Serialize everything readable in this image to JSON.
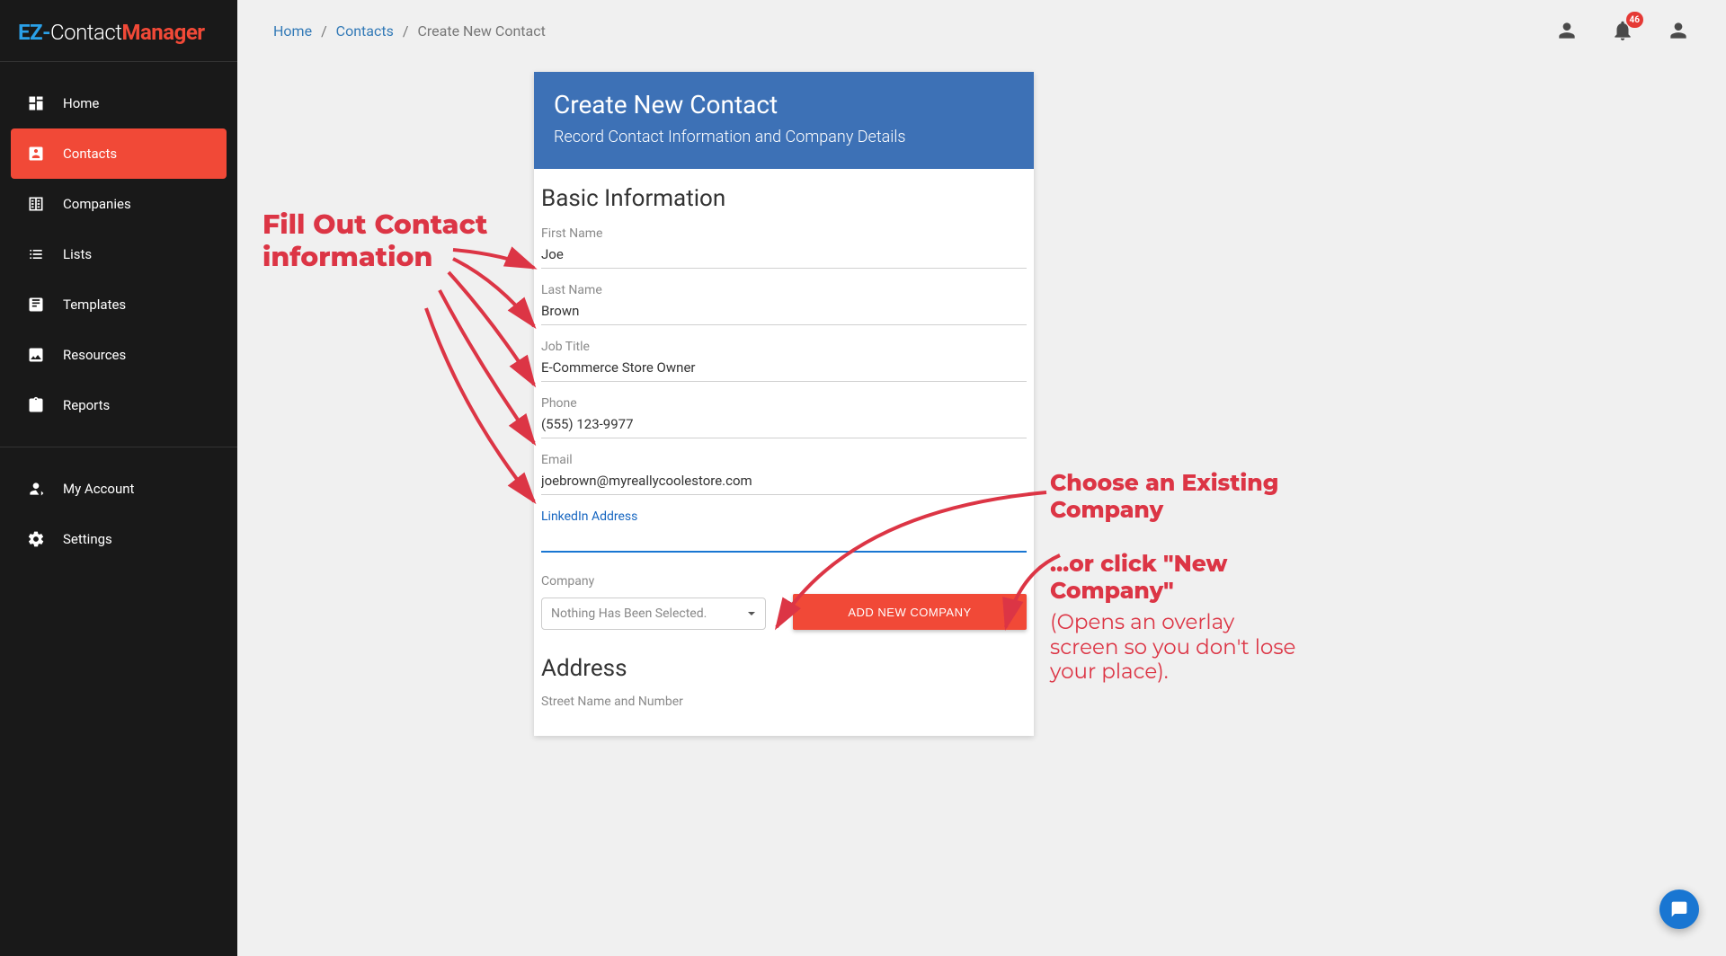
{
  "logo": {
    "p1": "EZ-",
    "p2": "Contact",
    "p3": "Manager"
  },
  "sidebar": {
    "items": [
      {
        "label": "Home"
      },
      {
        "label": "Contacts"
      },
      {
        "label": "Companies"
      },
      {
        "label": "Lists"
      },
      {
        "label": "Templates"
      },
      {
        "label": "Resources"
      },
      {
        "label": "Reports"
      }
    ],
    "items2": [
      {
        "label": "My Account"
      },
      {
        "label": "Settings"
      }
    ]
  },
  "breadcrumb": {
    "home": "Home",
    "contacts": "Contacts",
    "current": "Create New Contact"
  },
  "notifications": {
    "count": "46"
  },
  "card": {
    "title": "Create New Contact",
    "subtitle": "Record Contact Information and Company Details",
    "section_basic": "Basic Information",
    "section_address": "Address",
    "address_sub": "Street Name and Number",
    "fields": {
      "first_name": {
        "label": "First Name",
        "value": "Joe"
      },
      "last_name": {
        "label": "Last Name",
        "value": "Brown"
      },
      "job_title": {
        "label": "Job Title",
        "value": "E-Commerce Store Owner"
      },
      "phone": {
        "label": "Phone",
        "value": "(555) 123-9977"
      },
      "email": {
        "label": "Email",
        "value": "joebrown@myreallycoolestore.com"
      },
      "linkedin": {
        "label": "LinkedIn Address",
        "value": ""
      },
      "company": {
        "label": "Company",
        "selected": "Nothing Has Been Selected."
      }
    },
    "add_company_btn": "ADD NEW COMPANY"
  },
  "annot": {
    "left": "Fill Out Contact information",
    "right_h1": "Choose an Existing Company",
    "right_h2": "...or click \"New  Company\"",
    "right_small": "(Opens an overlay screen so you don't lose your place)."
  }
}
